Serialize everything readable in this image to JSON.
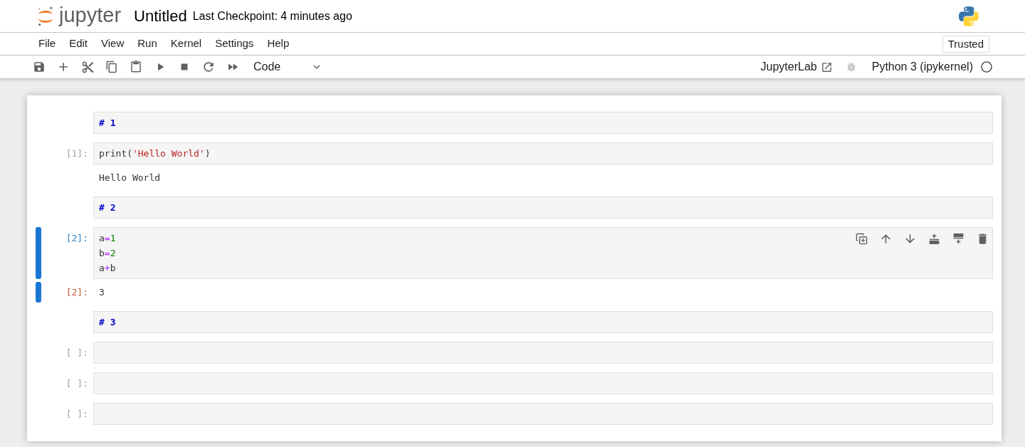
{
  "header": {
    "logo_text": "jupyter",
    "title": "Untitled",
    "checkpoint": "Last Checkpoint: 4 minutes ago"
  },
  "menu": {
    "items": [
      "File",
      "Edit",
      "View",
      "Run",
      "Kernel",
      "Settings",
      "Help"
    ],
    "trusted": "Trusted"
  },
  "toolbar": {
    "cell_type": "Code",
    "open_in": "JupyterLab",
    "debugger_enabled": false,
    "kernel": {
      "name": "Python 3 (ipykernel)",
      "busy": false
    }
  },
  "cells": [
    {
      "kind": "markdown",
      "selected": false,
      "source": "# 1"
    },
    {
      "kind": "code",
      "selected": false,
      "prompt": "[1]:",
      "lines": [
        [
          {
            "kind": "name",
            "text": "print("
          },
          {
            "kind": "string",
            "text": "'Hello World'"
          },
          {
            "kind": "name",
            "text": ")"
          }
        ]
      ],
      "outputs": [
        {
          "kind": "stream",
          "text": "Hello World"
        }
      ]
    },
    {
      "kind": "markdown",
      "selected": false,
      "source": "# 2"
    },
    {
      "kind": "code",
      "selected": true,
      "prompt": "[2]:",
      "lines": [
        [
          {
            "kind": "name",
            "text": "a"
          },
          {
            "kind": "operator",
            "text": "="
          },
          {
            "kind": "number",
            "text": "1"
          }
        ],
        [
          {
            "kind": "name",
            "text": "b"
          },
          {
            "kind": "operator",
            "text": "="
          },
          {
            "kind": "number",
            "text": "2"
          }
        ],
        [
          {
            "kind": "name",
            "text": "a"
          },
          {
            "kind": "operator",
            "text": "+"
          },
          {
            "kind": "name",
            "text": "b"
          }
        ]
      ],
      "outputs": [
        {
          "kind": "result",
          "prompt": "[2]:",
          "text": "3"
        }
      ]
    },
    {
      "kind": "markdown",
      "selected": false,
      "source": "# 3"
    },
    {
      "kind": "code",
      "selected": false,
      "prompt": "[ ]:"
    },
    {
      "kind": "code",
      "selected": false,
      "prompt": "[ ]:"
    },
    {
      "kind": "code",
      "selected": false,
      "prompt": "[ ]:"
    }
  ]
}
